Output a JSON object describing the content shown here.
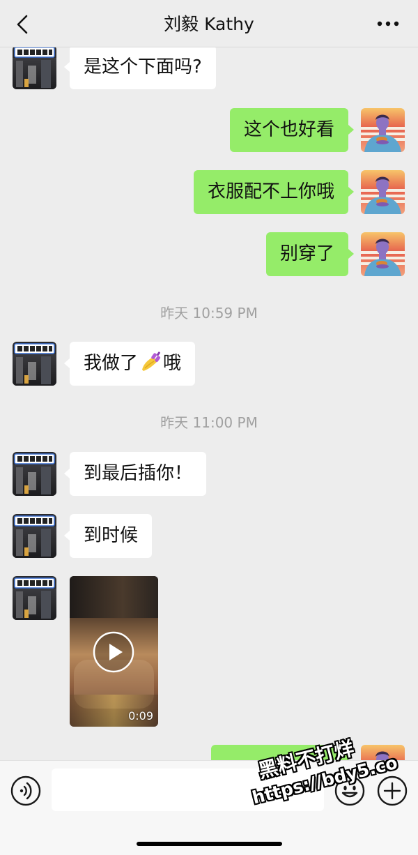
{
  "header": {
    "title": "刘毅 Kathy",
    "back_icon": "chevron-left-icon",
    "more_icon": "more-dots-icon"
  },
  "colors": {
    "background": "#ededed",
    "sent_bubble": "#95ec69",
    "received_bubble": "#ffffff",
    "timestamp_text": "#a0a0a0",
    "input_bar_background": "#f7f7f7"
  },
  "chat": {
    "items": [
      {
        "received_text": "是这个下面吗?"
      },
      {
        "sent_text": "这个也好看"
      },
      {
        "sent_text": "衣服配不上你哦"
      },
      {
        "sent_text": "别穿了"
      },
      {
        "timestamp": "昨天 10:59 PM"
      },
      {
        "received_text_before": "我做了",
        "received_emoji": "nail-polish-emoji",
        "received_text_after": "哦"
      },
      {
        "timestamp": "昨天 11:00 PM"
      },
      {
        "received_text": "到最后插你！"
      },
      {
        "received_text": "到时候"
      },
      {
        "received_video_duration": "0:09",
        "play_icon": "play-circle-icon"
      },
      {
        "sent_text": ""
      }
    ]
  },
  "input_bar": {
    "voice_icon": "voice-icon",
    "input_value": "",
    "emoji_icon": "emoji-icon",
    "plus_icon": "plus-icon"
  },
  "watermark": {
    "line1": "黑料不打烊",
    "line2": "https://bdy5.co"
  }
}
